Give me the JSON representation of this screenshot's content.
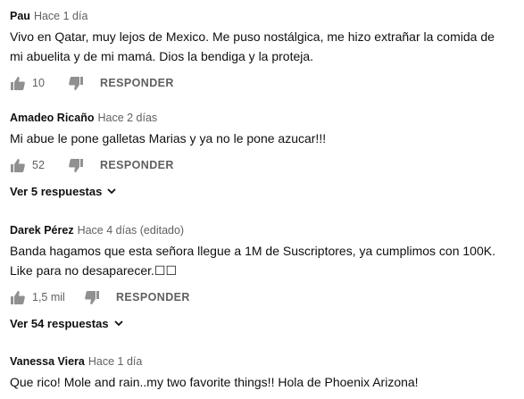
{
  "comments": [
    {
      "author": "Pau",
      "time": "Hace 1 día",
      "text": "Vivo en Qatar, muy lejos de Mexico. Me puso nostálgica, me hizo extrañar la comida de\nmi abuelita y de mi mamá. Dios la bendiga y la proteja.",
      "likes": "10",
      "reply": "RESPONDER"
    },
    {
      "author": "Amadeo Ricaño",
      "time": "Hace 2 días",
      "text": "Mi abue le pone galletas Marias y ya no le pone azucar!!!",
      "likes": "52",
      "reply": "RESPONDER",
      "view_replies": "Ver 5 respuestas"
    },
    {
      "author": "Darek Pérez",
      "time": "Hace 4 días (editado)",
      "text": "Banda hagamos que esta señora llegue a 1M de Suscriptores, ya cumplimos con 100K.\n Like para no desaparecer.☐☐",
      "likes": "1,5 mil",
      "reply": "RESPONDER",
      "view_replies": "Ver 54 respuestas"
    },
    {
      "author": "Vanessa Viera",
      "time": "Hace 1 día",
      "text": "Que rico! Mole and rain..my two favorite things!! Hola de Phoenix Arizona!"
    }
  ],
  "icons": {
    "like": "thumbs-up-icon",
    "dislike": "thumbs-down-icon",
    "expand": "chevron-down-icon"
  },
  "colors": {
    "text": "#0f0f0f",
    "secondary": "#606060",
    "icon": "#909090"
  }
}
